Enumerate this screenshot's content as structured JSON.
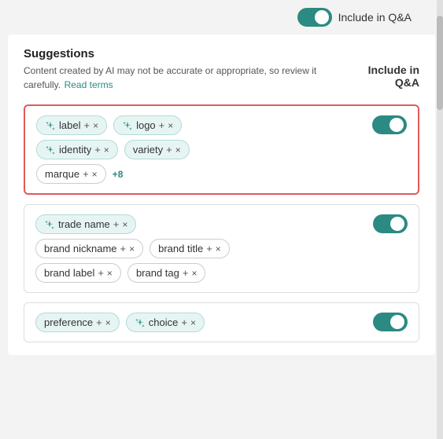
{
  "topBar": {
    "toggleLabel": "Include in Q&A",
    "toggle": true
  },
  "suggestions": {
    "title": "Suggestions",
    "description": "Content created by AI may not be accurate or appropriate, so review it carefully.",
    "readTerms": "Read terms",
    "columnHeader": "Include in Q&A"
  },
  "cards": [
    {
      "id": "card-1",
      "highlighted": true,
      "toggle": true,
      "rows": [
        [
          {
            "text": "label",
            "ai": true,
            "plain": false
          },
          {
            "text": "logo",
            "ai": true,
            "plain": false
          }
        ],
        [
          {
            "text": "identity",
            "ai": true,
            "plain": false
          },
          {
            "text": "variety",
            "ai": false,
            "plain": false
          }
        ],
        [
          {
            "text": "marque",
            "ai": false,
            "plain": true
          },
          {
            "badge": "+8"
          }
        ]
      ]
    },
    {
      "id": "card-2",
      "highlighted": false,
      "toggle": true,
      "rows": [
        [
          {
            "text": "trade name",
            "ai": true,
            "plain": false
          }
        ],
        [
          {
            "text": "brand nickname",
            "ai": false,
            "plain": true
          },
          {
            "text": "brand title",
            "ai": false,
            "plain": true
          }
        ],
        [
          {
            "text": "brand label",
            "ai": false,
            "plain": true
          },
          {
            "text": "brand tag",
            "ai": false,
            "plain": true
          }
        ]
      ]
    },
    {
      "id": "card-3",
      "highlighted": false,
      "toggle": true,
      "rows": [
        [
          {
            "text": "preference",
            "ai": false,
            "plain": false
          },
          {
            "text": "choice",
            "ai": true,
            "plain": false
          }
        ]
      ]
    }
  ]
}
